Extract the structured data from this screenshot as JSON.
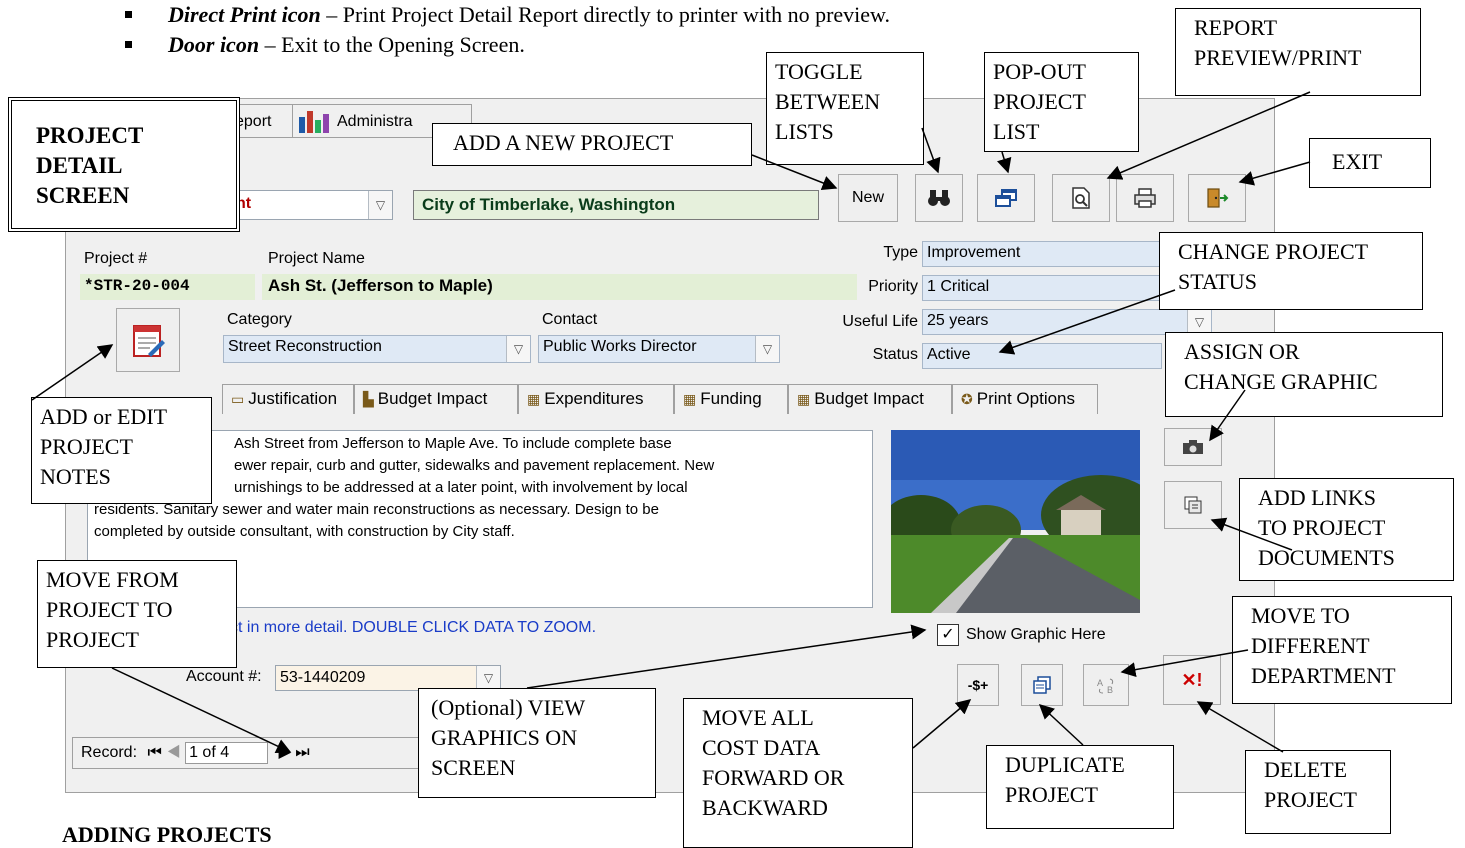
{
  "doc": {
    "bullets": [
      {
        "term": "Direct Print icon",
        "text": " – Print Project Detail Report directly to printer with no preview."
      },
      {
        "term": "Door icon",
        "text": " – Exit to the Opening Screen."
      }
    ],
    "next_heading": "ADDING PROJECTS"
  },
  "app": {
    "top_tabs": {
      "report": "eport",
      "admin": "Administra"
    },
    "dept_fragment": "nt",
    "organization": "City of Timberlake, Washington",
    "toolbar": {
      "new_label": "New"
    },
    "project": {
      "number_label": "Project #",
      "number": "*STR-20-004",
      "name_label": "Project Name",
      "name": "Ash St. (Jefferson to Maple)",
      "type_label": "Type",
      "type": "Improvement",
      "priority_label": "Priority",
      "priority": "1 Critical",
      "useful_life_label": "Useful Life",
      "useful_life": "25 years",
      "status_label": "Status",
      "status": "Active",
      "category_label": "Category",
      "category": "Street Reconstruction",
      "contact_label": "Contact",
      "contact": "Public Works Director"
    },
    "tabs": [
      "Justification",
      "Budget Impact",
      "Expenditures",
      "Funding",
      "Budget Impact",
      "Print Options"
    ],
    "notes": [
      "Ash Street from Jefferson to Maple Ave.  To include complete base",
      "ewer repair, curb and gutter, sidewalks and pavement replacement.  New",
      "urnishings to be addressed at a later point, with involvement by local",
      "residents.  Sanitary sewer and water main reconstructions as necessary.  Design to be",
      "completed by outside consultant, with construction by City staff."
    ],
    "hint": "ct in more detail.  DOUBLE CLICK DATA TO ZOOM.",
    "show_graphic_label": "Show Graphic Here",
    "show_graphic_checked": true,
    "account_label": "Account #:",
    "account": "53-1440209",
    "record": {
      "label": "Record:",
      "value": "1 of 4"
    },
    "bottom_buttons": {
      "cost_shift": "-$+"
    }
  },
  "callouts": {
    "project_detail": [
      "PROJECT",
      "DETAIL",
      "SCREEN"
    ],
    "add_new": "ADD A NEW PROJECT",
    "toggle": [
      "TOGGLE",
      "BETWEEN",
      "LISTS"
    ],
    "popout": [
      "POP-OUT",
      "PROJECT",
      "LIST"
    ],
    "report": [
      "REPORT",
      "PREVIEW/PRINT"
    ],
    "exit": "EXIT",
    "change_status": [
      "CHANGE PROJECT",
      "STATUS"
    ],
    "assign_graphic": [
      "ASSIGN OR",
      "CHANGE GRAPHIC"
    ],
    "notes": [
      "ADD or EDIT",
      "PROJECT",
      "NOTES"
    ],
    "links": [
      "ADD LINKS",
      "TO PROJECT",
      "DOCUMENTS"
    ],
    "move_project": [
      "MOVE FROM",
      "PROJECT TO",
      "PROJECT"
    ],
    "move_dept": [
      "MOVE TO",
      "DIFFERENT",
      "DEPARTMENT"
    ],
    "view_graphics": [
      "(Optional) VIEW",
      "GRAPHICS ON",
      "SCREEN"
    ],
    "move_cost": [
      "MOVE ALL",
      "COST DATA",
      "FORWARD OR",
      "BACKWARD"
    ],
    "duplicate": [
      "DUPLICATE",
      "PROJECT"
    ],
    "delete": [
      "DELETE",
      "PROJECT"
    ]
  }
}
